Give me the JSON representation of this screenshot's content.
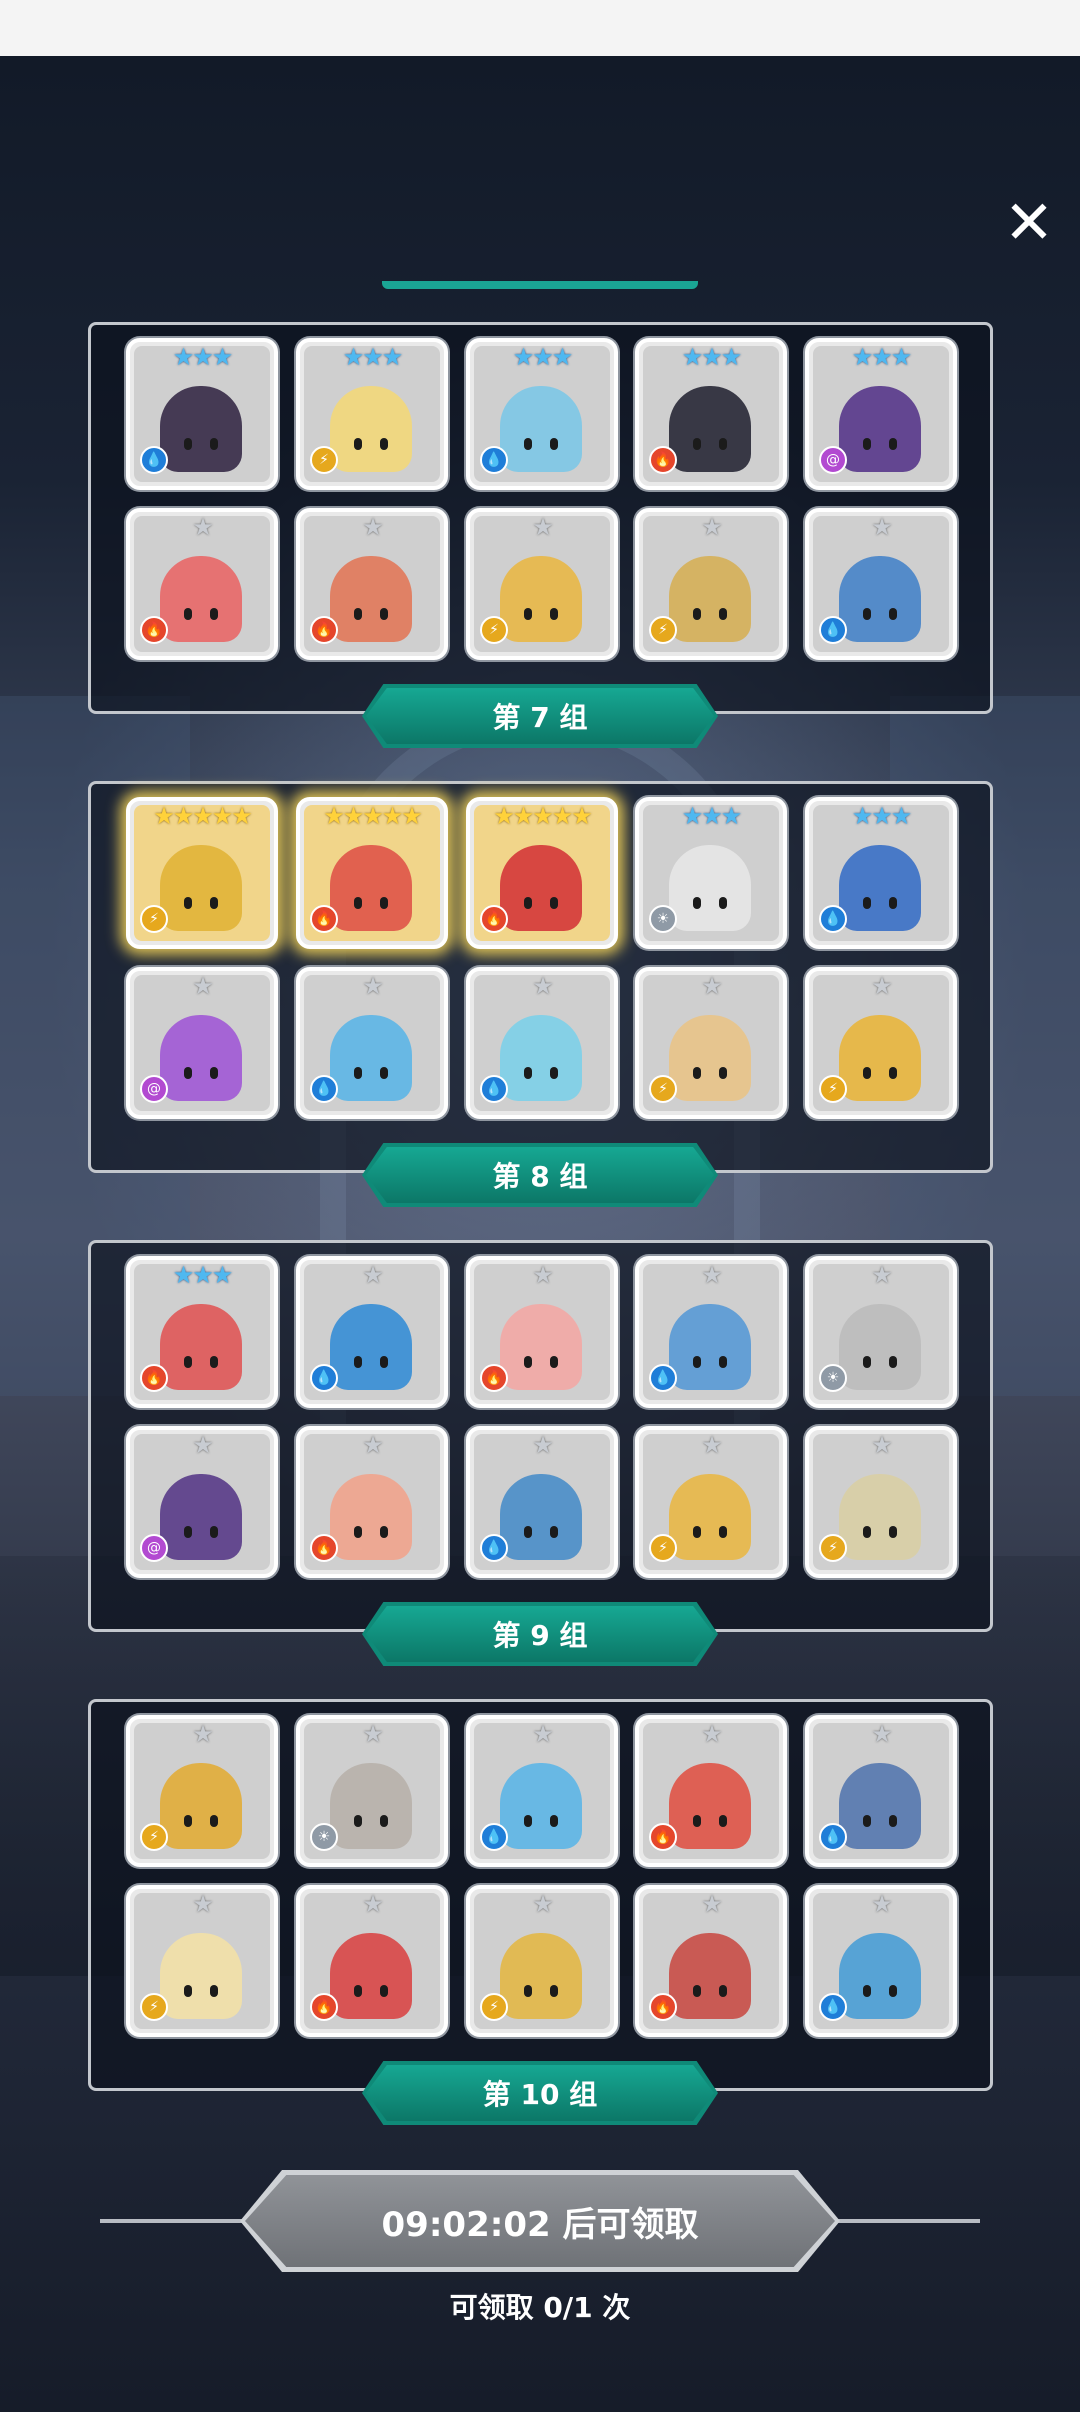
{
  "groups": [
    {
      "label": "第 7 组",
      "rows": [
        [
          {
            "stars": "★★★",
            "rank": 3,
            "element": "water",
            "portrait_color": "#3a2e4a",
            "name": "hero-ponytail-mask"
          },
          {
            "stars": "★★★",
            "rank": 3,
            "element": "wind",
            "portrait_color": "#f2d87c",
            "name": "hero-blonde-long-hair"
          },
          {
            "stars": "★★★",
            "rank": 3,
            "element": "water",
            "portrait_color": "#7fc8e6",
            "name": "hero-light-blue-hair"
          },
          {
            "stars": "★★★",
            "rank": 3,
            "element": "fire",
            "portrait_color": "#2b2b3a",
            "name": "hero-panda-red-hood"
          },
          {
            "stars": "★★★",
            "rank": 3,
            "element": "arcane",
            "portrait_color": "#5a3b8c",
            "name": "hero-panda-purple-hood"
          }
        ],
        [
          {
            "stars": "★",
            "rank": 1,
            "element": "fire",
            "portrait_color": "#e86a6a",
            "name": "hero-fox-red"
          },
          {
            "stars": "★",
            "rank": 1,
            "element": "fire",
            "portrait_color": "#e27b5c",
            "name": "hero-goggles-red"
          },
          {
            "stars": "★",
            "rank": 1,
            "element": "wind",
            "portrait_color": "#e8b94a",
            "name": "hero-blonde-winged"
          },
          {
            "stars": "★",
            "rank": 1,
            "element": "wind",
            "portrait_color": "#d6b15a",
            "name": "hero-horned-gold"
          },
          {
            "stars": "★",
            "rank": 1,
            "element": "water",
            "portrait_color": "#4a86c9",
            "name": "hero-blue-totem"
          }
        ]
      ]
    },
    {
      "label": "第 8 组",
      "rows": [
        [
          {
            "stars": "★★★★★",
            "rank": 5,
            "element": "wind",
            "portrait_color": "#e2b43a",
            "name": "hero-golden-lion",
            "gold": true
          },
          {
            "stars": "★★★★★",
            "rank": 5,
            "element": "fire",
            "portrait_color": "#e0574a",
            "name": "hero-red-demon",
            "gold": true
          },
          {
            "stars": "★★★★★",
            "rank": 5,
            "element": "fire",
            "portrait_color": "#d53b3b",
            "name": "hero-red-cyclops",
            "gold": true
          },
          {
            "stars": "★★★",
            "rank": 3,
            "element": "light",
            "portrait_color": "#e6e6e6",
            "name": "hero-white-hair"
          },
          {
            "stars": "★★★",
            "rank": 3,
            "element": "water",
            "portrait_color": "#3d72c7",
            "name": "hero-blue-princess"
          }
        ],
        [
          {
            "stars": "★",
            "rank": 1,
            "element": "arcane",
            "portrait_color": "#a25bd6",
            "name": "hero-purple-cactus"
          },
          {
            "stars": "★",
            "rank": 1,
            "element": "water",
            "portrait_color": "#5fb6e6",
            "name": "hero-blue-spiky-monster"
          },
          {
            "stars": "★",
            "rank": 1,
            "element": "water",
            "portrait_color": "#7fd0e8",
            "name": "hero-blue-cat-girl"
          },
          {
            "stars": "★",
            "rank": 1,
            "element": "wind",
            "portrait_color": "#e8c48a",
            "name": "hero-mushroom-hat"
          },
          {
            "stars": "★",
            "rank": 1,
            "element": "wind",
            "portrait_color": "#e8b640",
            "name": "hero-yellow-castle"
          }
        ]
      ]
    },
    {
      "label": "第 9 组",
      "rows": [
        [
          {
            "stars": "★★★",
            "rank": 3,
            "element": "fire",
            "portrait_color": "#e05a5a",
            "name": "hero-red-fighter"
          },
          {
            "stars": "★",
            "rank": 1,
            "element": "water",
            "portrait_color": "#3a8fd6",
            "name": "hero-blue-fluffball"
          },
          {
            "stars": "★",
            "rank": 1,
            "element": "fire",
            "portrait_color": "#f2a9a6",
            "name": "hero-pink-blob"
          },
          {
            "stars": "★",
            "rank": 1,
            "element": "water",
            "portrait_color": "#5b9bd6",
            "name": "hero-blue-goggles"
          },
          {
            "stars": "★",
            "rank": 1,
            "element": "light",
            "portrait_color": "#bdbdbd",
            "name": "hero-silver-goggles"
          }
        ],
        [
          {
            "stars": "★",
            "rank": 1,
            "element": "arcane",
            "portrait_color": "#5b3e8a",
            "name": "hero-purple-ninja"
          },
          {
            "stars": "★",
            "rank": 1,
            "element": "fire",
            "portrait_color": "#f0a58e",
            "name": "hero-flower-girl"
          },
          {
            "stars": "★",
            "rank": 1,
            "element": "water",
            "portrait_color": "#4d8fc9",
            "name": "hero-blue-castle"
          },
          {
            "stars": "★",
            "rank": 1,
            "element": "wind",
            "portrait_color": "#e8b94a",
            "name": "hero-blonde-winged-2"
          },
          {
            "stars": "★",
            "rank": 1,
            "element": "wind",
            "portrait_color": "#d9cfa6",
            "name": "hero-white-helmet"
          }
        ]
      ]
    },
    {
      "label": "第 10 组",
      "rows": [
        [
          {
            "stars": "★",
            "rank": 1,
            "element": "wind",
            "portrait_color": "#e2ae3c",
            "name": "hero-golden-tree"
          },
          {
            "stars": "★",
            "rank": 1,
            "element": "light",
            "portrait_color": "#b9b2ab",
            "name": "hero-grey-tree"
          },
          {
            "stars": "★",
            "rank": 1,
            "element": "water",
            "portrait_color": "#5fb6e6",
            "name": "hero-blue-bow-girl"
          },
          {
            "stars": "★",
            "rank": 1,
            "element": "fire",
            "portrait_color": "#e0574a",
            "name": "hero-red-wolf"
          },
          {
            "stars": "★",
            "rank": 1,
            "element": "water",
            "portrait_color": "#5879b0",
            "name": "hero-blue-knight"
          }
        ],
        [
          {
            "stars": "★",
            "rank": 1,
            "element": "wind",
            "portrait_color": "#f2e1a8",
            "name": "hero-blonde-flower"
          },
          {
            "stars": "★",
            "rank": 1,
            "element": "fire",
            "portrait_color": "#d94a4a",
            "name": "hero-card-soldier-red"
          },
          {
            "stars": "★",
            "rank": 1,
            "element": "wind",
            "portrait_color": "#e3b84a",
            "name": "hero-card-soldier-gold"
          },
          {
            "stars": "★",
            "rank": 1,
            "element": "fire",
            "portrait_color": "#c9504a",
            "name": "hero-red-totem"
          },
          {
            "stars": "★",
            "rank": 1,
            "element": "water",
            "portrait_color": "#4d9fd6",
            "name": "hero-blue-beast"
          }
        ]
      ]
    }
  ],
  "claim_button": "09:02:02 后可领取",
  "claim_count": "可领取 0/1 次",
  "element_glyphs": {
    "water": "💧",
    "fire": "🔥",
    "wind": "⚡",
    "arcane": "@",
    "light": "☀"
  },
  "colors": {
    "accent_teal": "#1aa594",
    "panel_border": "#c3c7cd",
    "button_grey": "#7f8287"
  }
}
